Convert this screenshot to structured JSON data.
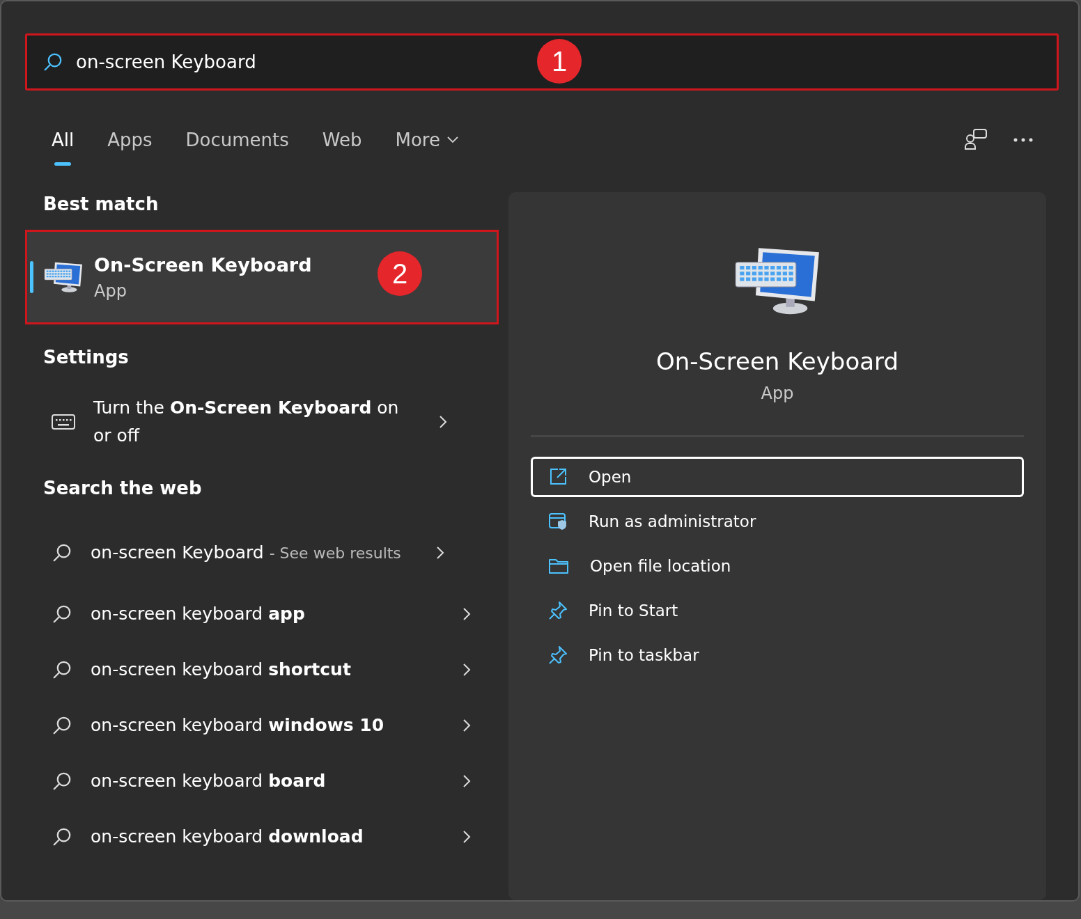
{
  "search": {
    "value": "on-screen Keyboard",
    "annotation": "1"
  },
  "tabs": [
    {
      "label": "All",
      "selected": true,
      "dropdown": false
    },
    {
      "label": "Apps",
      "selected": false,
      "dropdown": false
    },
    {
      "label": "Documents",
      "selected": false,
      "dropdown": false
    },
    {
      "label": "Web",
      "selected": false,
      "dropdown": false
    },
    {
      "label": "More",
      "selected": false,
      "dropdown": true
    }
  ],
  "best_match": {
    "heading": "Best match",
    "title": "On-Screen Keyboard",
    "subtitle": "App",
    "selected": true,
    "annotation": "2"
  },
  "settings": {
    "heading": "Settings",
    "items": [
      {
        "text": "Turn the **On-Screen Keyboard** on or off"
      }
    ]
  },
  "web": {
    "heading": "Search the web",
    "items": [
      {
        "text": "on-screen Keyboard",
        "suffix": "- See web results"
      },
      {
        "text": "on-screen keyboard **app**"
      },
      {
        "text": "on-screen keyboard **shortcut**"
      },
      {
        "text": "on-screen keyboard **windows 10**"
      },
      {
        "text": "on-screen keyboard **board**"
      },
      {
        "text": "on-screen keyboard **download**"
      }
    ]
  },
  "preview": {
    "title": "On-Screen Keyboard",
    "subtitle": "App",
    "actions": [
      {
        "label": "Open",
        "kind": "open",
        "focused": true
      },
      {
        "label": "Run as administrator",
        "kind": "admin",
        "focused": false
      },
      {
        "label": "Open file location",
        "kind": "folder",
        "focused": false
      },
      {
        "label": "Pin to Start",
        "kind": "pin",
        "focused": false
      },
      {
        "label": "Pin to taskbar",
        "kind": "pin",
        "focused": false
      }
    ]
  }
}
